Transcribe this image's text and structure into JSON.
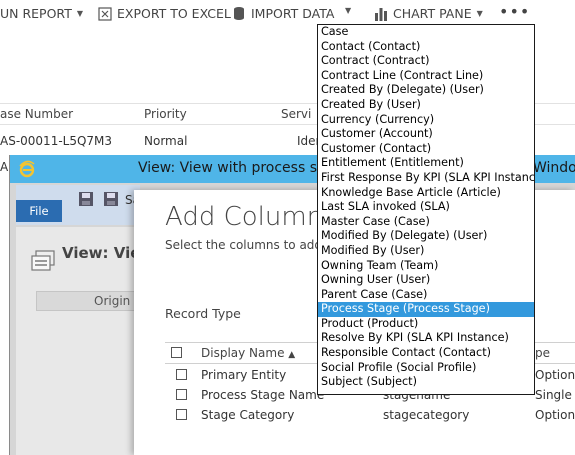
{
  "toolbar": {
    "report_label": "UN REPORT",
    "excel_label": "EXPORT TO EXCEL",
    "import_label": "IMPORT DATA",
    "chart_label": "CHART PANE",
    "more_label": "•••"
  },
  "grid": {
    "headers": [
      "ase Number",
      "Priority",
      "Servi"
    ],
    "row": [
      "AS-00011-L5Q7M3",
      "Normal",
      "Iden"
    ],
    "row2_first": "AS"
  },
  "view_window": {
    "title": "View: View with process stag",
    "title_tail": "Windo",
    "file_tab": "File",
    "save_cut": "Sa",
    "view_label": "View: View",
    "origin_col": "Origin"
  },
  "dialog": {
    "title": "Add Columns",
    "subtitle": "Select the columns to add to",
    "record_type_label": "Record Type",
    "table": {
      "header_display_name": "Display Name",
      "header_type": "pe",
      "rows": [
        {
          "display": "Primary Entity",
          "name": "",
          "type": "Option S"
        },
        {
          "display": "Process Stage Name",
          "name": "stagename",
          "type": "Single L"
        },
        {
          "display": "Stage Category",
          "name": "stagecategory",
          "type": "Option S"
        }
      ]
    }
  },
  "dropdown": {
    "selected_index": 19,
    "items": [
      "Case",
      "Contact (Contact)",
      "Contract (Contract)",
      "Contract Line (Contract Line)",
      "Created By (Delegate) (User)",
      "Created By (User)",
      "Currency (Currency)",
      "Customer (Account)",
      "Customer (Contact)",
      "Entitlement (Entitlement)",
      "First Response By KPI (SLA KPI Instance)",
      "Knowledge Base Article (Article)",
      "Last SLA invoked (SLA)",
      "Master Case (Case)",
      "Modified By (Delegate) (User)",
      "Modified By (User)",
      "Owning Team (Team)",
      "Owning User (User)",
      "Parent Case (Case)",
      "Process Stage (Process Stage)",
      "Product (Product)",
      "Resolve By KPI (SLA KPI Instance)",
      "Responsible Contact (Contact)",
      "Social Profile (Social Profile)",
      "Subject (Subject)"
    ]
  },
  "colors": {
    "title_bar": "#4fb5e8",
    "file_tab": "#2b6cb1",
    "selection": "#3399dd"
  }
}
